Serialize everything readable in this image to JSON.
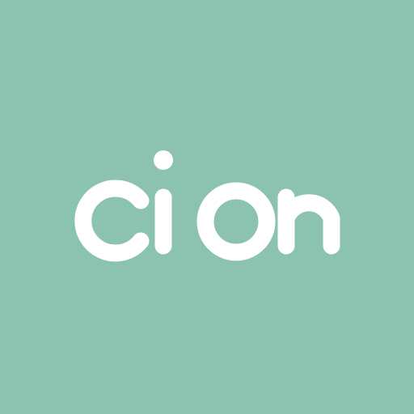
{
  "app": {
    "logo_text": "cion",
    "background_color": "#8bc3b0",
    "logo_color": "#ffffff"
  }
}
